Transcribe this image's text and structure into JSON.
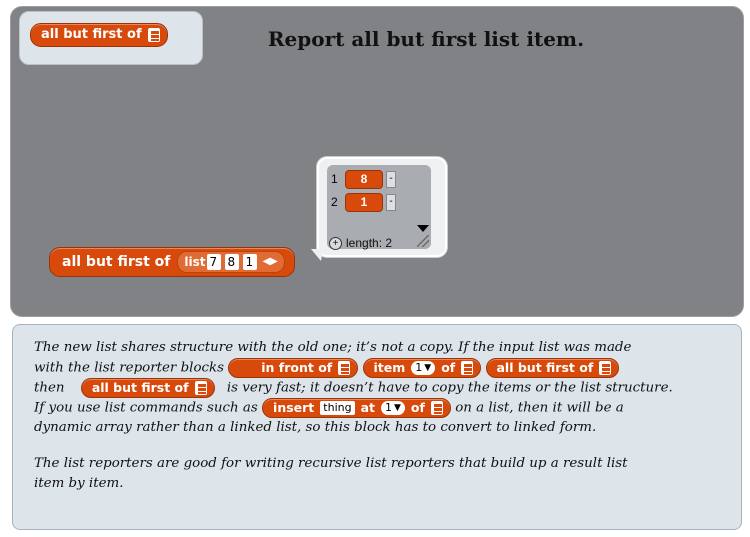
{
  "header": {
    "tag_block_label": "all but first of",
    "title": "Report all but first list item."
  },
  "example": {
    "block_label": "all but first of",
    "list_label": "list",
    "list_items": [
      "7",
      "8",
      "1"
    ]
  },
  "watcher": {
    "rows": [
      {
        "index": "1",
        "value": "8"
      },
      {
        "index": "2",
        "value": "1"
      }
    ],
    "length_label": "length: 2",
    "remove_label": "-",
    "add_label": "+"
  },
  "explanation": {
    "p1_a": "The new list shares structure with the old one; it’s not a copy.  If the input list was made",
    "p1_b": "with the list reporter blocks",
    "then": "then",
    "fast": "is very fast; it doesn’t have to copy the items or the list structure.",
    "if_use": "If you use list commands such as",
    "on_list": "on a list, then it will be a",
    "p1_end": "dynamic array rather than a linked list, so this block has to convert to linked form.",
    "p2_a": "The list reporters are good for writing recursive list reporters that build up a result list",
    "p2_b": "item by item.",
    "blocks": {
      "in_front_of": "in front of",
      "item": "item",
      "item_index": "1",
      "of": "of",
      "all_but_first": "all but first of",
      "insert": "insert",
      "insert_value": "thing",
      "at": "at",
      "at_index": "1"
    }
  }
}
